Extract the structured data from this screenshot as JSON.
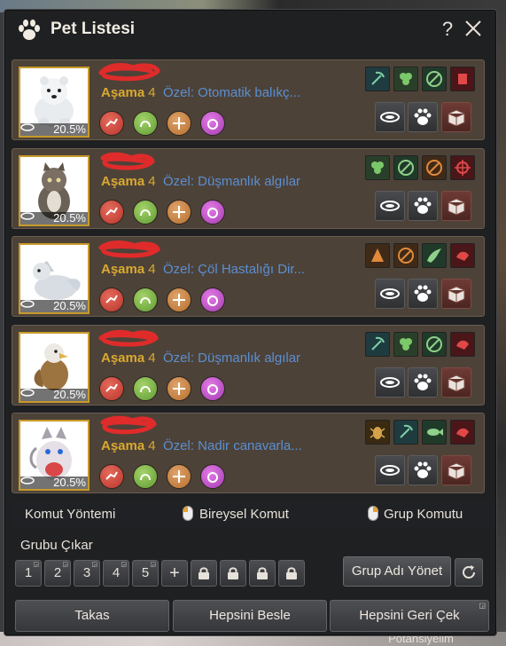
{
  "window": {
    "title": "Pet Listesi",
    "help": "?"
  },
  "background": {
    "bottom_label": "Potansiyelim"
  },
  "labels": {
    "stage": "Aşama"
  },
  "pets": [
    {
      "stage": "4",
      "special": "Özel: Otomatik balıkç...",
      "food": "20.5%"
    },
    {
      "stage": "4",
      "special": "Özel: Düşmanlık algılar",
      "food": "20.5%"
    },
    {
      "stage": "4",
      "special": "Özel: Çöl Hastalığı Dir...",
      "food": "20.5%"
    },
    {
      "stage": "4",
      "special": "Özel: Düşmanlık algılar",
      "food": "20.5%"
    },
    {
      "stage": "4",
      "special": "Özel: Nadir canavarla...",
      "food": "20.5%"
    }
  ],
  "controls": {
    "command_method": "Komut Yöntemi",
    "individual_command": "Bireysel Komut",
    "group_command": "Grup Komutu",
    "leave_group": "Grubu Çıkar",
    "group_buttons": [
      "1",
      "2",
      "3",
      "4",
      "5",
      "+"
    ],
    "manage_group_name": "Grup Adı Yönet",
    "trade": "Takas",
    "feed_all": "Hepsini Besle",
    "recall_all": "Hepsini Geri Çek"
  },
  "colors": {
    "stage_label": "#d9a932",
    "special_text": "#5a8fd2",
    "portrait_border": "#c89a2a",
    "card_bg": "#4d4238"
  }
}
